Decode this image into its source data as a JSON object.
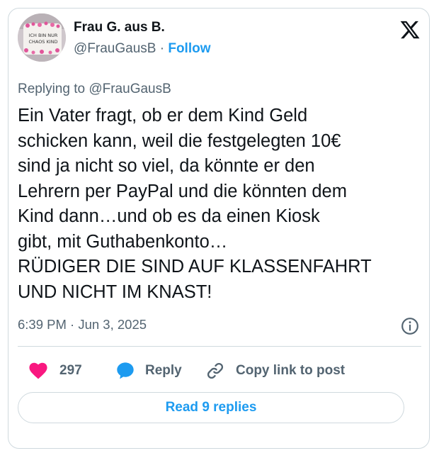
{
  "author": {
    "name": "Frau G. aus B.",
    "handle": "@FrauGausB",
    "separator": "·",
    "follow_label": "Follow",
    "avatar_text_line1": "ICH BIN NUR",
    "avatar_text_line2": "CHAOS KIND",
    "avatar_icon": "mug-photo"
  },
  "reply_context": "Replying to @FrauGausB",
  "text": "Ein Vater fragt, ob er dem Kind Geld\nschicken kann, weil die festgelegten 10€\nsind ja nicht so viel, da könnte er den\nLehrern per PayPal und die könnten dem\nKind dann…und ob es da einen Kiosk\ngibt, mit Guthabenkonto…\nRÜDIGER DIE SIND AUF KLASSENFAHRT\nUND NICHT IM KNAST!",
  "timestamp": "6:39 PM · Jun 3, 2025",
  "actions": {
    "like_count": "297",
    "reply_label": "Reply",
    "copy_label": "Copy link to post"
  },
  "read_replies_label": "Read 9 replies",
  "colors": {
    "accent": "#1d9bf0",
    "heart": "#f91880",
    "muted": "#536471",
    "text": "#0f1419",
    "border": "#cfd9de"
  },
  "icons": [
    "x-logo-icon",
    "info-icon",
    "heart-icon",
    "reply-bubble-icon",
    "link-icon"
  ]
}
